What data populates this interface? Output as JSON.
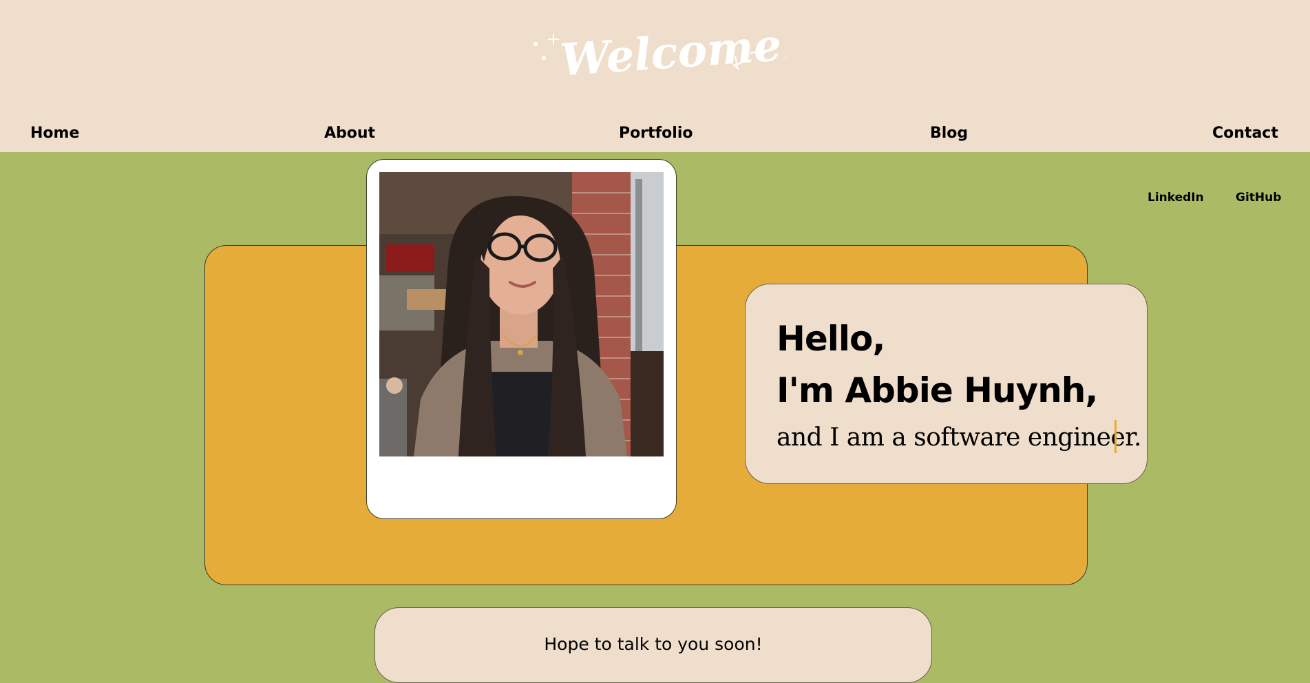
{
  "header": {
    "logo_text": "Welcome!",
    "nav": {
      "home": "Home",
      "about": "About",
      "portfolio": "Portfolio",
      "blog": "Blog",
      "contact": "Contact"
    }
  },
  "social": {
    "linkedin": "LinkedIn",
    "github": "GitHub"
  },
  "intro": {
    "greeting": "Hello,",
    "name": "I'm Abbie Huynh,",
    "role": "and I am a software engineer."
  },
  "message": "Hope to talk to you soon!",
  "colors": {
    "header_bg": "#EFDECB",
    "page_bg": "#ABBB65",
    "hero_bg": "#E6AC3A",
    "card_bg": "#EFDECB",
    "polaroid_bg": "#FFFFFF",
    "cursor": "#E6AC3A",
    "logo_text": "#FFFFFF"
  }
}
